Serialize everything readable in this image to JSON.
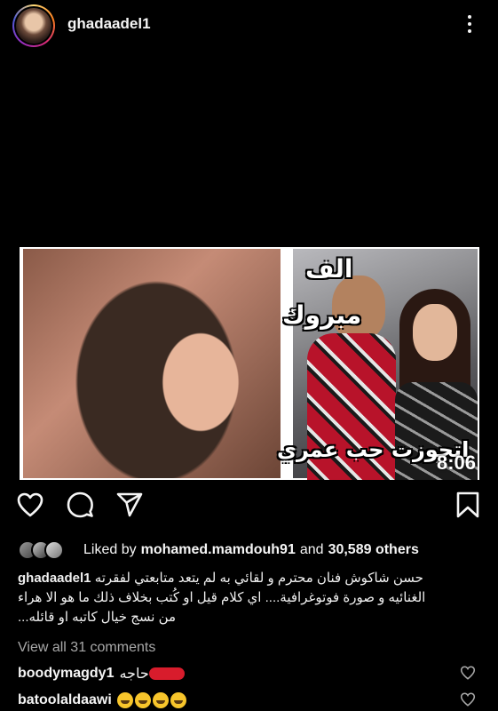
{
  "header": {
    "username": "ghadaadel1"
  },
  "media": {
    "overlay_line1": "الف",
    "overlay_line2": "مبروك",
    "overlay_line3": "اتجوزت حب عمري",
    "duration": "8:06"
  },
  "actions": {
    "icons": [
      "heart-icon",
      "comment-icon",
      "share-icon",
      "bookmark-icon"
    ]
  },
  "likes": {
    "prefix": "Liked by",
    "user": "mohamed.mamdouh91",
    "middle": "and",
    "others": "30,589 others"
  },
  "caption": {
    "user": "ghadaadel1",
    "line1": "حسن شاكوش فنان محترم و لقائي به لم يتعد متابعتي لفقرته",
    "line2": "الغنائيه و صورة فوتوغرافية.... اي كلام قيل او كُتب بخلاف ذلك ما هو الا هراء",
    "line3": "من نسج خيال كاتبه او قائله..."
  },
  "comments": {
    "view_all": "View all 31 comments",
    "items": [
      {
        "user": "boodymagdy1",
        "text": "حاجه"
      },
      {
        "user": "batoolaldaawi",
        "text": ""
      }
    ]
  },
  "colors": {
    "background": "#000000",
    "text": "#f5f5f5",
    "muted": "#a8a8a8"
  }
}
